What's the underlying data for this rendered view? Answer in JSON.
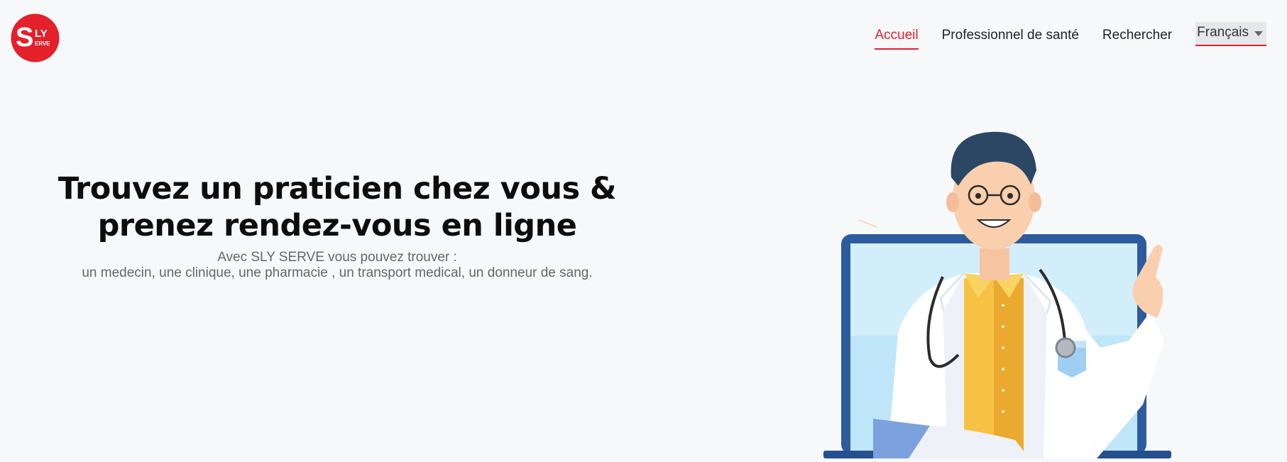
{
  "logo": {
    "big_letter": "S",
    "line1": "LY",
    "line2": "ERVE"
  },
  "nav": {
    "items": [
      {
        "label": "Accueil",
        "active": true
      },
      {
        "label": "Professionnel de santé",
        "active": false
      },
      {
        "label": "Rechercher",
        "active": false
      }
    ],
    "language": "Français"
  },
  "hero": {
    "title_line1": "Trouvez un praticien chez vous &",
    "title_line2": "prenez rendez-vous en ligne",
    "subtitle_line1": "Avec SLY SERVE vous pouvez trouver :",
    "subtitle_line2": "un medecin, une clinique, une pharmacie , un transport medical, un donneur de sang."
  },
  "colors": {
    "accent": "#e4202b",
    "background": "#f7f8fa",
    "laptop": "#2e5b9e",
    "coat": "#ffffff",
    "shirt": "#f7c244",
    "hair": "#2b4764"
  },
  "icons": [
    "sly-serve-logo",
    "chevron-down-icon",
    "doctor-illustration"
  ]
}
